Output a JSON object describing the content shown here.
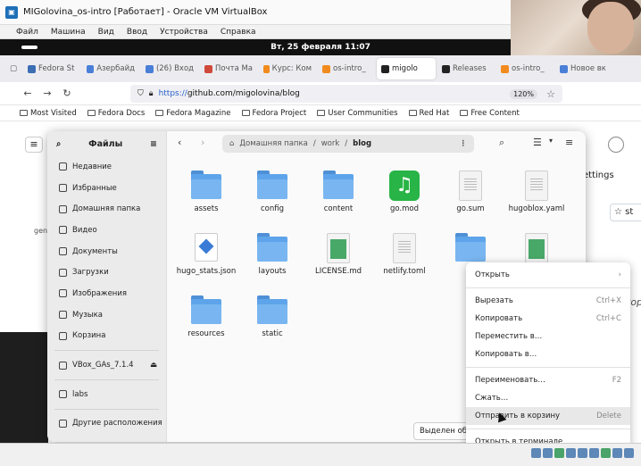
{
  "window": {
    "title": "MIGolovina_os-intro [Работает] - Oracle VM VirtualBox"
  },
  "vbox_menu": [
    "Файл",
    "Машина",
    "Вид",
    "Ввод",
    "Устройства",
    "Справка"
  ],
  "guest_bar": {
    "clock": "Вт, 25 февраля  11:07"
  },
  "browser": {
    "tabs": [
      {
        "label": "Fedora St",
        "icon": "fedora-icon"
      },
      {
        "label": "Азербайд",
        "icon": "site-icon"
      },
      {
        "label": "(26) Вход",
        "icon": "site-icon"
      },
      {
        "label": "Почта Ma",
        "icon": "mail-icon"
      },
      {
        "label": "Курс: Ком",
        "icon": "course-icon"
      },
      {
        "label": "os-intro_",
        "icon": "course-icon"
      },
      {
        "label": "migolo",
        "icon": "github-icon"
      },
      {
        "label": "Releases",
        "icon": "github-icon"
      },
      {
        "label": "os-intro_",
        "icon": "course-icon"
      },
      {
        "label": "Новое вк",
        "icon": "site-icon"
      }
    ],
    "url_prefix": "https://",
    "url": "github.com/migolovina/blog",
    "zoom": "120%",
    "bookmarks": [
      "Most Visited",
      "Fedora Docs",
      "Fedora Magazine",
      "Fedora Project",
      "User Communities",
      "Red Hat",
      "Free Content"
    ]
  },
  "github": {
    "settings": "ettings",
    "star": "st",
    "side_text": "top",
    "side_label": "gen"
  },
  "files": {
    "title": "Файлы",
    "sidebar": [
      "Недавние",
      "Избранные",
      "Домашняя папка",
      "Видео",
      "Документы",
      "Загрузки",
      "Изображения",
      "Музыка",
      "Корзина"
    ],
    "devices": [
      "VBox_GAs_7.1.4"
    ],
    "bookmarks": [
      "labs"
    ],
    "other": "Другие расположения",
    "path": [
      "Домашняя папка",
      "work",
      "blog"
    ],
    "items": [
      {
        "name": "assets",
        "type": "folder"
      },
      {
        "name": "config",
        "type": "folder"
      },
      {
        "name": "content",
        "type": "folder"
      },
      {
        "name": "go.mod",
        "type": "gomod"
      },
      {
        "name": "go.sum",
        "type": "doc"
      },
      {
        "name": "hugoblox.yaml",
        "type": "doc"
      },
      {
        "name": "hugo_stats.json",
        "type": "hugo"
      },
      {
        "name": "layouts",
        "type": "folder"
      },
      {
        "name": "LICENSE.md",
        "type": "md"
      },
      {
        "name": "netlify.toml",
        "type": "doc"
      },
      {
        "name": "p",
        "type": "folder"
      },
      {
        "name": "",
        "type": "md"
      },
      {
        "name": "resources",
        "type": "folder"
      },
      {
        "name": "static",
        "type": "folder"
      }
    ],
    "status": "Выделен объ"
  },
  "context_menu": [
    {
      "label": "Открыть",
      "accel": "›"
    },
    {
      "sep": true
    },
    {
      "label": "Вырезать",
      "accel": "Ctrl+X"
    },
    {
      "label": "Копировать",
      "accel": "Ctrl+C"
    },
    {
      "label": "Переместить в…",
      "accel": ""
    },
    {
      "label": "Копировать в…",
      "accel": ""
    },
    {
      "sep": true
    },
    {
      "label": "Переименовать…",
      "accel": "F2"
    },
    {
      "label": "Сжать…",
      "accel": ""
    },
    {
      "label": "Отправить в корзину",
      "accel": "Delete"
    },
    {
      "sep": true
    },
    {
      "label": "Открыть в терминале",
      "accel": ""
    }
  ]
}
